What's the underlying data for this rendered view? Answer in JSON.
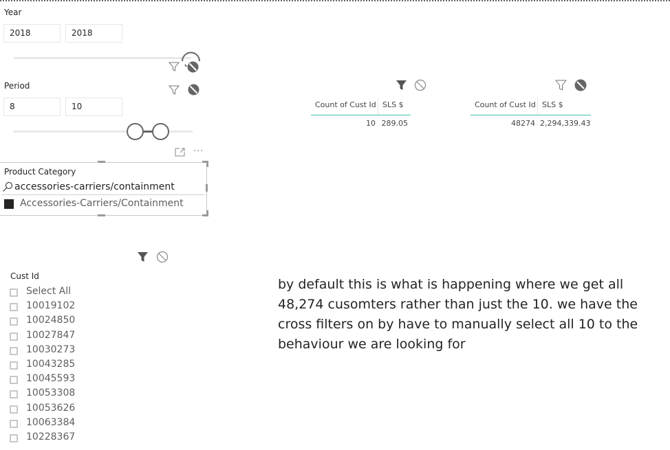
{
  "year_slicer": {
    "title": "Year",
    "start_value": "2018",
    "end_value": "2018",
    "range_fraction": [
      1.0,
      1.0
    ]
  },
  "period_slicer": {
    "title": "Period",
    "start_value": "8",
    "end_value": "10",
    "range_fraction": [
      0.68,
      0.82
    ]
  },
  "product_category_slicer": {
    "title": "Product Category",
    "search_value": "accessories-carriers/containment",
    "items": [
      {
        "label": "Accessories-Carriers/Containment",
        "checked": true
      }
    ]
  },
  "table_filtered": {
    "columns": [
      "Count of Cust Id",
      "SLS $"
    ],
    "rows": [
      [
        "10",
        "289.05"
      ]
    ]
  },
  "table_total": {
    "columns": [
      "Count of Cust Id",
      "SLS $"
    ],
    "rows": [
      [
        "48274",
        "2,294,339.43"
      ]
    ]
  },
  "cust_id_slicer": {
    "title": "Cust Id",
    "items": [
      {
        "label": "Select All",
        "checked": false
      },
      {
        "label": "10019102",
        "checked": false
      },
      {
        "label": "10024850",
        "checked": false
      },
      {
        "label": "10027847",
        "checked": false
      },
      {
        "label": "10030273",
        "checked": false
      },
      {
        "label": "10043285",
        "checked": false
      },
      {
        "label": "10045593",
        "checked": false
      },
      {
        "label": "10053308",
        "checked": false
      },
      {
        "label": "10053626",
        "checked": false
      },
      {
        "label": "10063384",
        "checked": false
      },
      {
        "label": "10228367",
        "checked": false
      }
    ]
  },
  "note": {
    "text": "by default this is what is happening where we get all 48,274 cusomters rather than just the 10.  we have the cross filters on by have to manually select all 10 to the behaviour we are looking for"
  },
  "colors": {
    "table_header_underline": "#3fbfb0",
    "icon_gray": "#666666",
    "slider_track": "#e8e8e8"
  }
}
